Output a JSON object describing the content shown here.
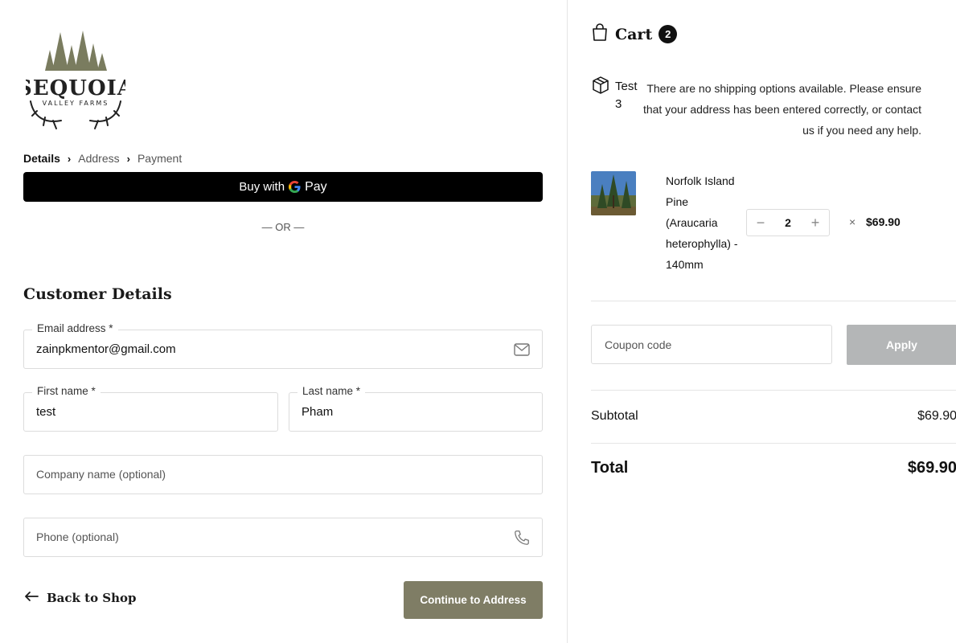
{
  "logo": {
    "wordmark": "SEQUOIA",
    "tagline": "VALLEY FARMS"
  },
  "breadcrumbs": [
    "Details",
    "Address",
    "Payment"
  ],
  "express": {
    "label_prefix": "Buy with",
    "g": "G",
    "pay": "Pay"
  },
  "or_divider": "— OR —",
  "customer": {
    "title": "Customer Details",
    "email": {
      "label": "Email address *",
      "value": "zainpkmentor@gmail.com"
    },
    "first_name": {
      "label": "First name *",
      "value": "test"
    },
    "last_name": {
      "label": "Last name *",
      "value": "Pham"
    },
    "company": {
      "placeholder": "Company name (optional)"
    },
    "phone": {
      "placeholder": "Phone (optional)"
    }
  },
  "actions": {
    "back": "Back to Shop",
    "continue": "Continue to Address"
  },
  "cart": {
    "title": "Cart",
    "count": "2",
    "shipping": {
      "label": "Test 3",
      "message": "There are no shipping options available. Please ensure that your address has been entered correctly, or contact us if you need any help."
    },
    "item": {
      "name": "Norfolk Island Pine (Araucaria heterophylla) - 140mm",
      "quantity": "2",
      "times": "×",
      "price": "$69.90"
    },
    "coupon_placeholder": "Coupon code",
    "apply": "Apply",
    "subtotal_label": "Subtotal",
    "subtotal": "$69.90",
    "total_label": "Total",
    "total": "$69.90"
  },
  "colors": {
    "continue_bg": "#7f7d65",
    "apply_bg": "#b4b6b7",
    "logo_tree": "#7a7c5f",
    "logo_text": "#222222"
  }
}
